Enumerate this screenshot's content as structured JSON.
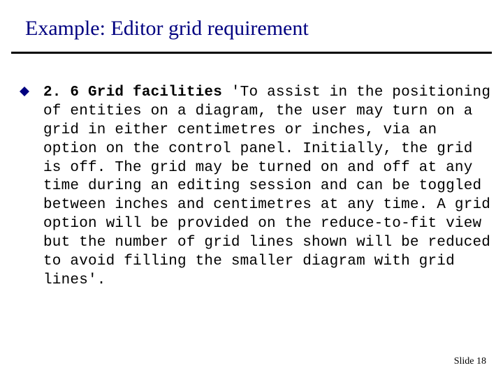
{
  "title": "Example: Editor grid requirement",
  "bullet_glyph": "◆",
  "requirement": {
    "label": "2. 6 Grid facilities",
    "text": "'To assist in the positioning of entities on a diagram, the user may turn on a grid in either centimetres or inches, via an option on the control panel. Initially, the grid is off. The grid may be turned on and off at any time during an editing session and can be toggled between inches and centimetres at any time. A grid option will be provided on the reduce-to-fit view but the number of grid lines shown will be reduced to avoid filling the smaller diagram with grid lines'."
  },
  "footer": {
    "slide_word": "Slide",
    "slide_number": "18"
  }
}
